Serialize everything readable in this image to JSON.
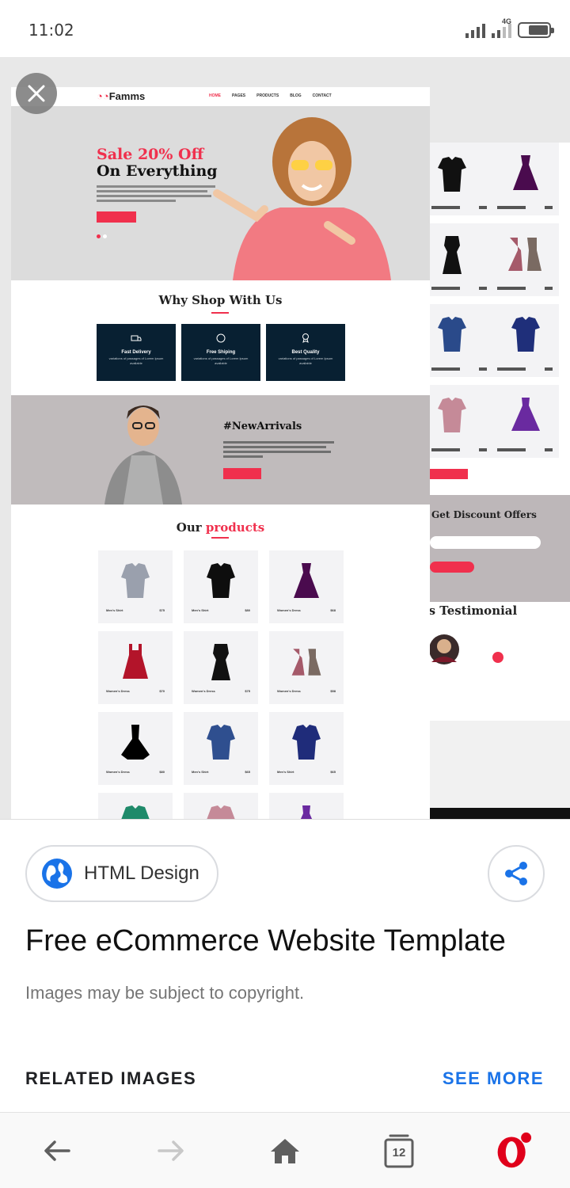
{
  "status_bar": {
    "time": "11:02",
    "network": "4G"
  },
  "preview": {
    "template": {
      "logo": "Famms",
      "menu": [
        "HOME",
        "PAGES",
        "PRODUCTS",
        "BLOG",
        "CONTACT"
      ],
      "hero": {
        "headline_1": "Sale 20% Off",
        "headline_2": "On Everything",
        "button": "Shop Now"
      },
      "why": {
        "title": "Why Shop With Us",
        "features": [
          {
            "name": "Fast Delivery",
            "desc": "variations of passages of Lorem Ipsum available"
          },
          {
            "name": "Free Shiping",
            "desc": "variations of passages of Lorem Ipsum available"
          },
          {
            "name": "Best Quality",
            "desc": "variations of passages of Lorem Ipsum available"
          }
        ]
      },
      "arrivals": {
        "title": "#NewArrivals",
        "button": "Shop Now"
      },
      "products": {
        "title_prefix": "Our ",
        "title_highlight": "products",
        "items": [
          {
            "name": "Men's Shirt",
            "price": "$75"
          },
          {
            "name": "Men's Shirt",
            "price": "$80"
          },
          {
            "name": "Women's Dress",
            "price": "$68"
          },
          {
            "name": "Women's Dress",
            "price": "$70"
          },
          {
            "name": "Women's Dress",
            "price": "$75"
          },
          {
            "name": "Women's Dress",
            "price": "$58"
          },
          {
            "name": "Women's Dress",
            "price": "$80"
          },
          {
            "name": "Men's Shirt",
            "price": "$65"
          },
          {
            "name": "Men's Shirt",
            "price": "$65"
          }
        ]
      },
      "right_side": {
        "discount_title": "Get Discount Offers",
        "testimonial_title": "'s Testimonial"
      }
    }
  },
  "info": {
    "source_chip": "HTML Design",
    "title": "Free eCommerce Website Template",
    "copyright": "Images may be subject to copyright.",
    "related": "RELATED IMAGES",
    "see_more": "SEE MORE"
  },
  "bottom_nav": {
    "tabs_count": "12"
  },
  "colors": {
    "accent_red": "#f0304d",
    "feature_navy": "#082032",
    "link_blue": "#1a73e8"
  }
}
